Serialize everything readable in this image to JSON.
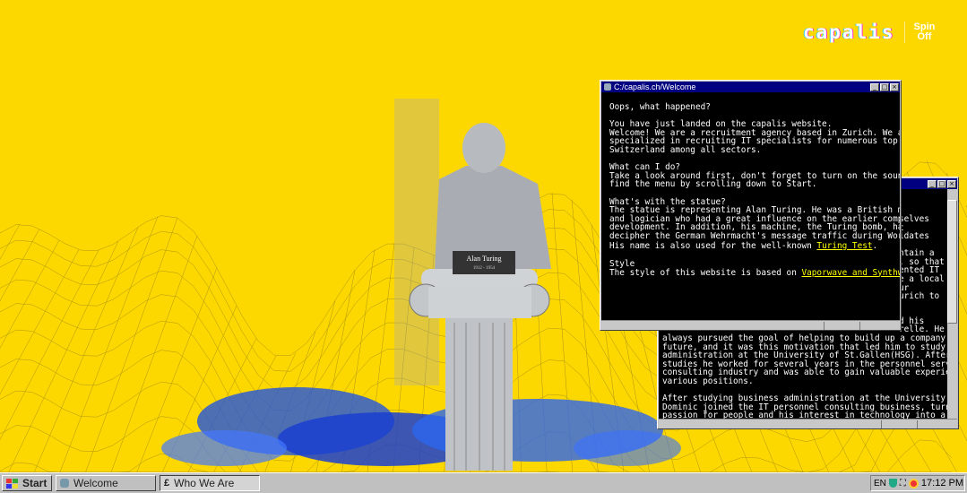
{
  "logo": {
    "brand": "capalis",
    "badge_line1": "Spin",
    "badge_line2": "Off"
  },
  "welcome_window": {
    "title": "C:/capalis.ch/Welcome",
    "heading1": "Oops, what happened?",
    "para1": "You have just landed on the capalis website.\nWelcome! We are a recruitment agency based in Zurich. We are\nspecialized in recruiting IT specialists for numerous top companies in\nSwitzerland among all sectors.",
    "heading2": "What can I do?",
    "para2": "Take a look around first, don't forget to turn on the sound! You will\nfind the menu by scrolling down to Start.",
    "heading3": "What's with the statue?",
    "para3": "The statue is representing Alan Turing. He was a British mathematician\nand logician who had a great influence on the earlier computer\ndevelopment. In addition, his machine, the Turing bomb, had helped to\ndecipher the German Wehrmacht's message traffic during World War II.",
    "para4_prefix": "His name is also used for the well-known ",
    "link_turing": "Turing Test",
    "heading4": "Style",
    "para5_prefix": "The style of this website is based on ",
    "link_style": "Vaporwave and Synthwave",
    "period": "."
  },
  "who_window": {
    "fragments": [
      "selves",
      "t",
      "idates",
      "ntain a",
      ", so that",
      "ented IT",
      "e a local",
      "ur",
      "urich to",
      "d his",
      "relle. He"
    ],
    "lines": [
      "always pursued the goal of helping to build up a company in the",
      "future, and it was this motivation that led him to study business",
      "administration at the University of St.Gallen(HSG). After his",
      "studies he worked for several years in the personnel service and",
      "consulting industry and was able to gain valuable experience in",
      "various positions.",
      "",
      "After studying business administration at the University of Berne,",
      "Dominic joined the IT personnel consulting business, turning his",
      "passion for people and his interest in technology into a career."
    ]
  },
  "statue": {
    "plaque_name": "Alan Turing",
    "plaque_years": "1912 - 1954"
  },
  "taskbar": {
    "start": "Start",
    "tasks": [
      "Welcome",
      "Who We Are"
    ],
    "lang": "EN",
    "clock": "17:12 PM"
  }
}
